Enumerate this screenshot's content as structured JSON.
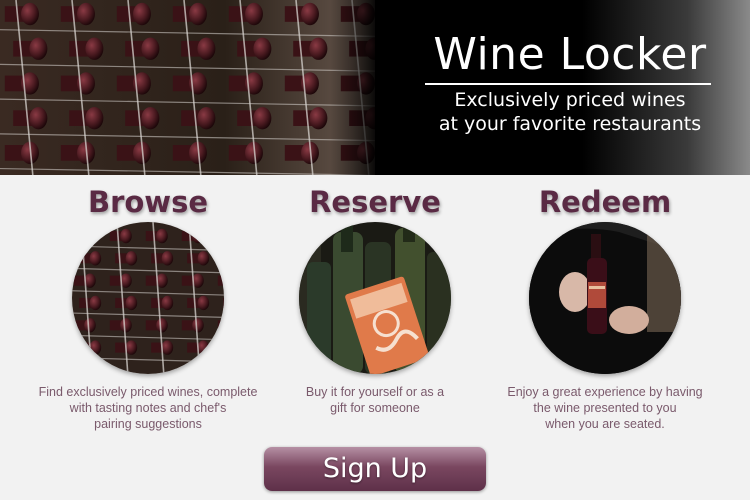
{
  "hero": {
    "title": "Wine Locker",
    "tagline_line1": "Exclusively priced wines",
    "tagline_line2": "at your favorite restaurants"
  },
  "steps": [
    {
      "heading": "Browse",
      "image": "wine-rack-photo",
      "desc_lines": [
        "Find exclusively priced wines, complete",
        "with tasting notes and chef's",
        "pairing suggestions"
      ]
    },
    {
      "heading": "Reserve",
      "image": "gift-bottles-photo",
      "desc_lines": [
        "Buy it for yourself or as a",
        "gift for someone"
      ]
    },
    {
      "heading": "Redeem",
      "image": "wine-presentation-photo",
      "desc_lines": [
        "Enjoy a great experience by having",
        "the wine presented to you",
        "when you are seated."
      ]
    }
  ],
  "signup": {
    "label": "Sign Up"
  },
  "colors": {
    "heading": "#5a2a44",
    "description": "#7a5a6c",
    "button_top": "#b590a4",
    "button_bottom": "#5e3049",
    "background": "#f2f2f2"
  }
}
